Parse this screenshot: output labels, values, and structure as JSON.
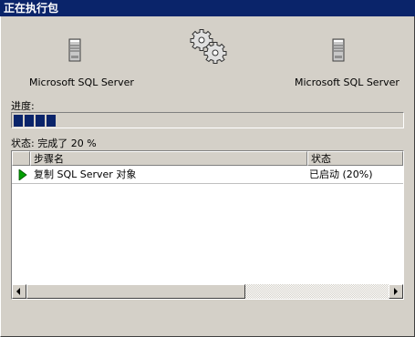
{
  "window": {
    "title": "正在执行包"
  },
  "source_server": {
    "label": "Microsoft SQL Server",
    "icon": "database-server-icon"
  },
  "destination_server": {
    "label": "Microsoft SQL Server",
    "icon": "database-server-icon"
  },
  "gears_icon": "gears-icon",
  "progress": {
    "label": "进度:",
    "value": 0.2,
    "blocks_filled": 4
  },
  "status": {
    "text": "状态: 完成了 20 %"
  },
  "steps_table": {
    "columns": [
      "步骤名",
      "状态"
    ],
    "rows": [
      {
        "name": "复制 SQL Server 对象",
        "status": "已启动 (20%)",
        "icon": "play-arrow-icon"
      }
    ]
  },
  "colors": {
    "titlebar": "#0a246a",
    "progress": "#0a246a",
    "dialog_bg": "#d4d0c8",
    "run_icon": "#00a000"
  }
}
